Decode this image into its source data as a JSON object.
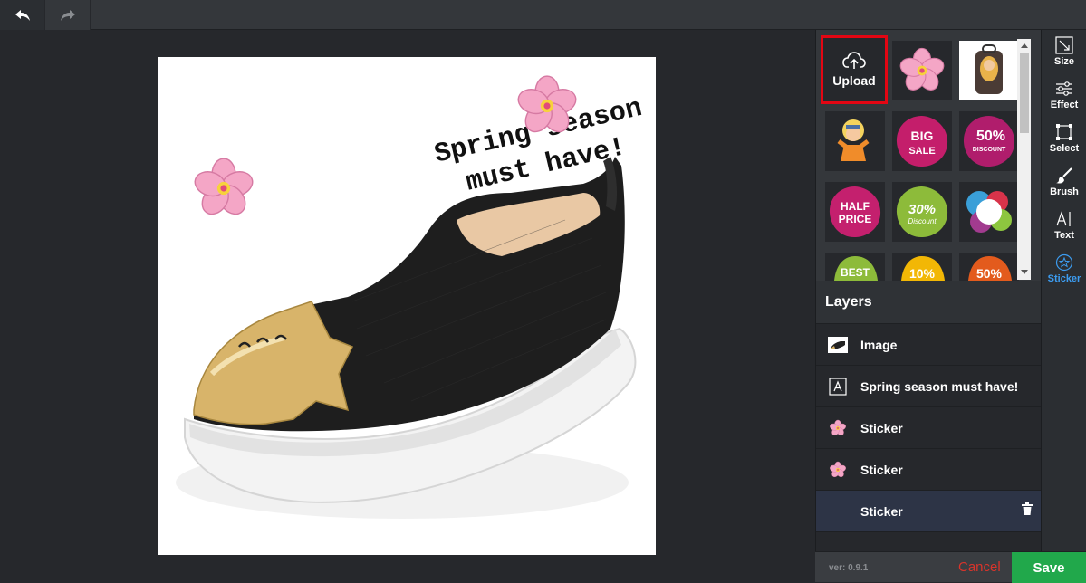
{
  "toolbar_top": {
    "undo_icon": "undo-arrow-icon",
    "redo_icon": "redo-arrow-icon"
  },
  "canvas": {
    "caption_line1": "Spring season",
    "caption_line2": "must have!",
    "product": "black slip-on shoe with gold toe cap"
  },
  "stickers": {
    "upload_label": "Upload",
    "items": [
      "sakura-flower",
      "backpack-photo",
      "ninja-cartoon",
      "big-sale-badge",
      "50-discount-badge",
      "half-price-badge",
      "30-discount-badge",
      "paint-splash",
      "best-badge",
      "10-badge",
      "50-badge"
    ],
    "badge_text": {
      "big_sale_1": "BIG",
      "big_sale_2": "SALE",
      "d50_1": "50%",
      "d50_2": "DISCOUNT",
      "half_1": "HALF",
      "half_2": "PRICE",
      "d30_1": "30%",
      "d30_2": "Discount",
      "best": "BEST",
      "ten": "10%",
      "fifty": "50%"
    }
  },
  "layers": {
    "title": "Layers",
    "items": [
      {
        "label": "Image",
        "icon": "image-thumbnail-icon"
      },
      {
        "label": "Spring season must have!",
        "icon": "text-a-icon"
      },
      {
        "label": "Sticker",
        "icon": "flower-icon"
      },
      {
        "label": "Sticker",
        "icon": "flower-icon"
      },
      {
        "label": "Sticker",
        "icon": "none"
      }
    ]
  },
  "footer": {
    "version": "ver: 0.9.1",
    "cancel": "Cancel",
    "save": "Save"
  },
  "tools": [
    {
      "label": "Size",
      "icon": "resize-icon"
    },
    {
      "label": "Effect",
      "icon": "sliders-icon"
    },
    {
      "label": "Select",
      "icon": "select-frame-icon"
    },
    {
      "label": "Brush",
      "icon": "brush-icon"
    },
    {
      "label": "Text",
      "icon": "text-cursor-icon"
    },
    {
      "label": "Sticker",
      "icon": "star-circle-icon",
      "active": true
    }
  ],
  "colors": {
    "accent": "#3c9cf0",
    "save_bg": "#21a84b",
    "cancel": "#d9342b",
    "upload_border": "#e30613"
  }
}
